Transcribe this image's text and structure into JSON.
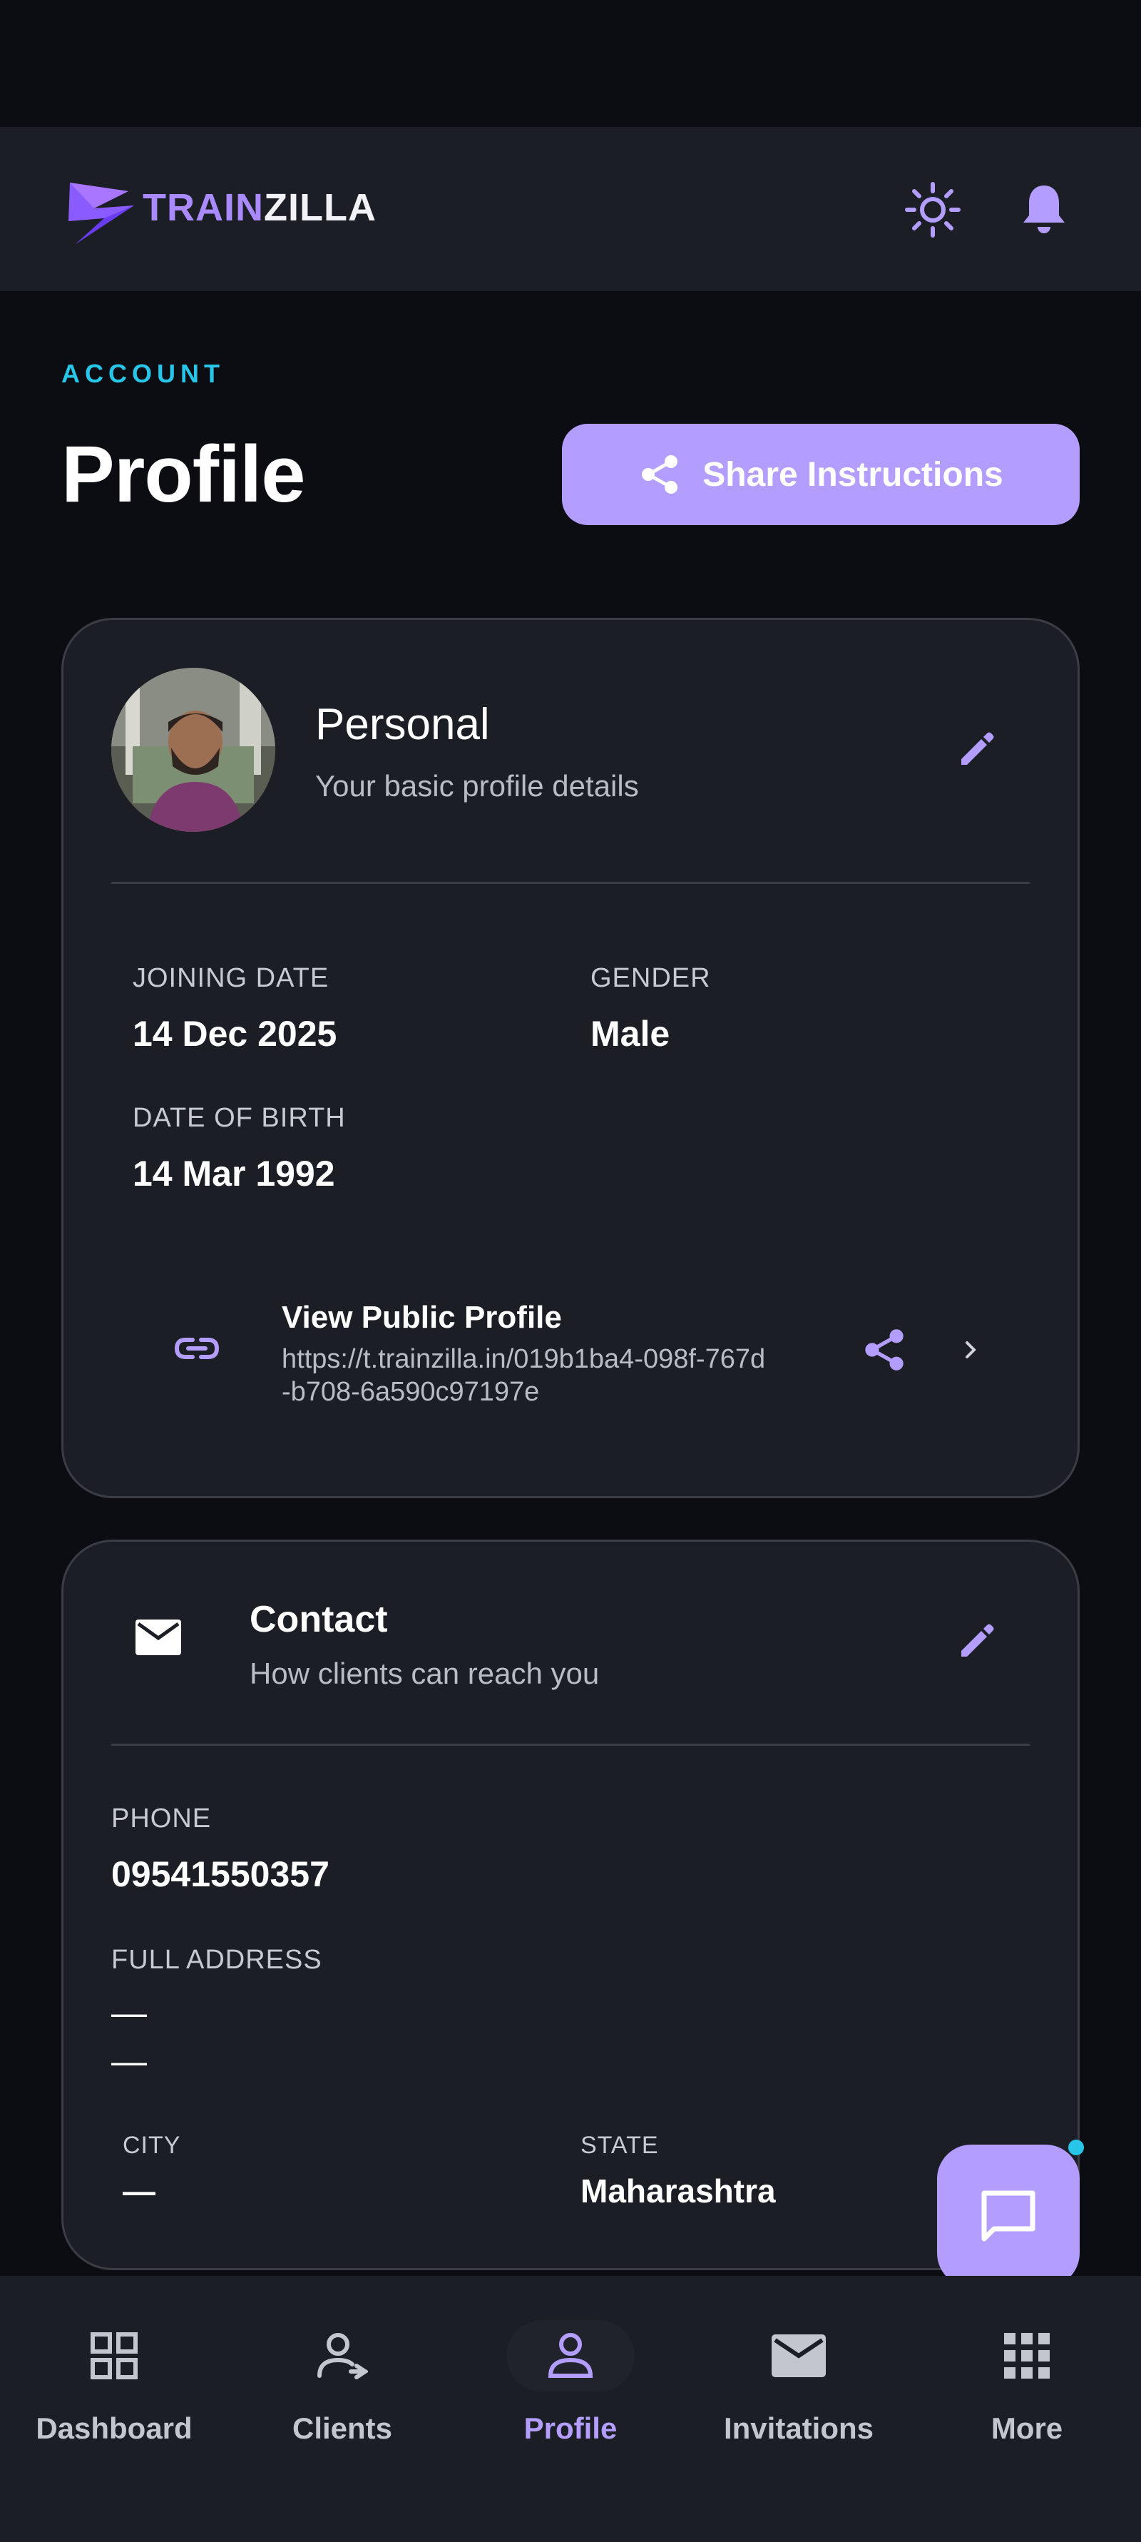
{
  "app": {
    "brand_part1": "TRAIN",
    "brand_part2": "ZILLA"
  },
  "header": {
    "eyebrow": "ACCOUNT",
    "title": "Profile",
    "share_button": "Share Instructions"
  },
  "personal": {
    "title": "Personal",
    "subtitle": "Your basic profile details",
    "fields": {
      "joining_label": "JOINING DATE",
      "joining_value": "14 Dec 2025",
      "gender_label": "GENDER",
      "gender_value": "Male",
      "dob_label": "DATE OF BIRTH",
      "dob_value": "14 Mar 1992"
    },
    "public_profile": {
      "title": "View Public Profile",
      "url_line1": "https://t.trainzilla.in/019b1ba4-098f-767d",
      "url_line2": "-b708-6a590c97197e"
    }
  },
  "contact": {
    "title": "Contact",
    "subtitle": "How clients can reach you",
    "phone_label": "PHONE",
    "phone_value": "09541550357",
    "address_label": "FULL ADDRESS",
    "address_line1": "—",
    "address_line2": "—",
    "city_label": "CITY",
    "city_value": "—",
    "state_label": "STATE",
    "state_value": "Maharashtra"
  },
  "nav": [
    {
      "label": "Dashboard",
      "icon": "grid-icon"
    },
    {
      "label": "Clients",
      "icon": "clients-icon"
    },
    {
      "label": "Profile",
      "icon": "person-icon",
      "active": true
    },
    {
      "label": "Invitations",
      "icon": "mail-icon"
    },
    {
      "label": "More",
      "icon": "apps-icon"
    }
  ],
  "colors": {
    "accent": "#b39dff",
    "cyan": "#27c6e8",
    "background": "#0b0d12",
    "card": "#1b1e25"
  }
}
